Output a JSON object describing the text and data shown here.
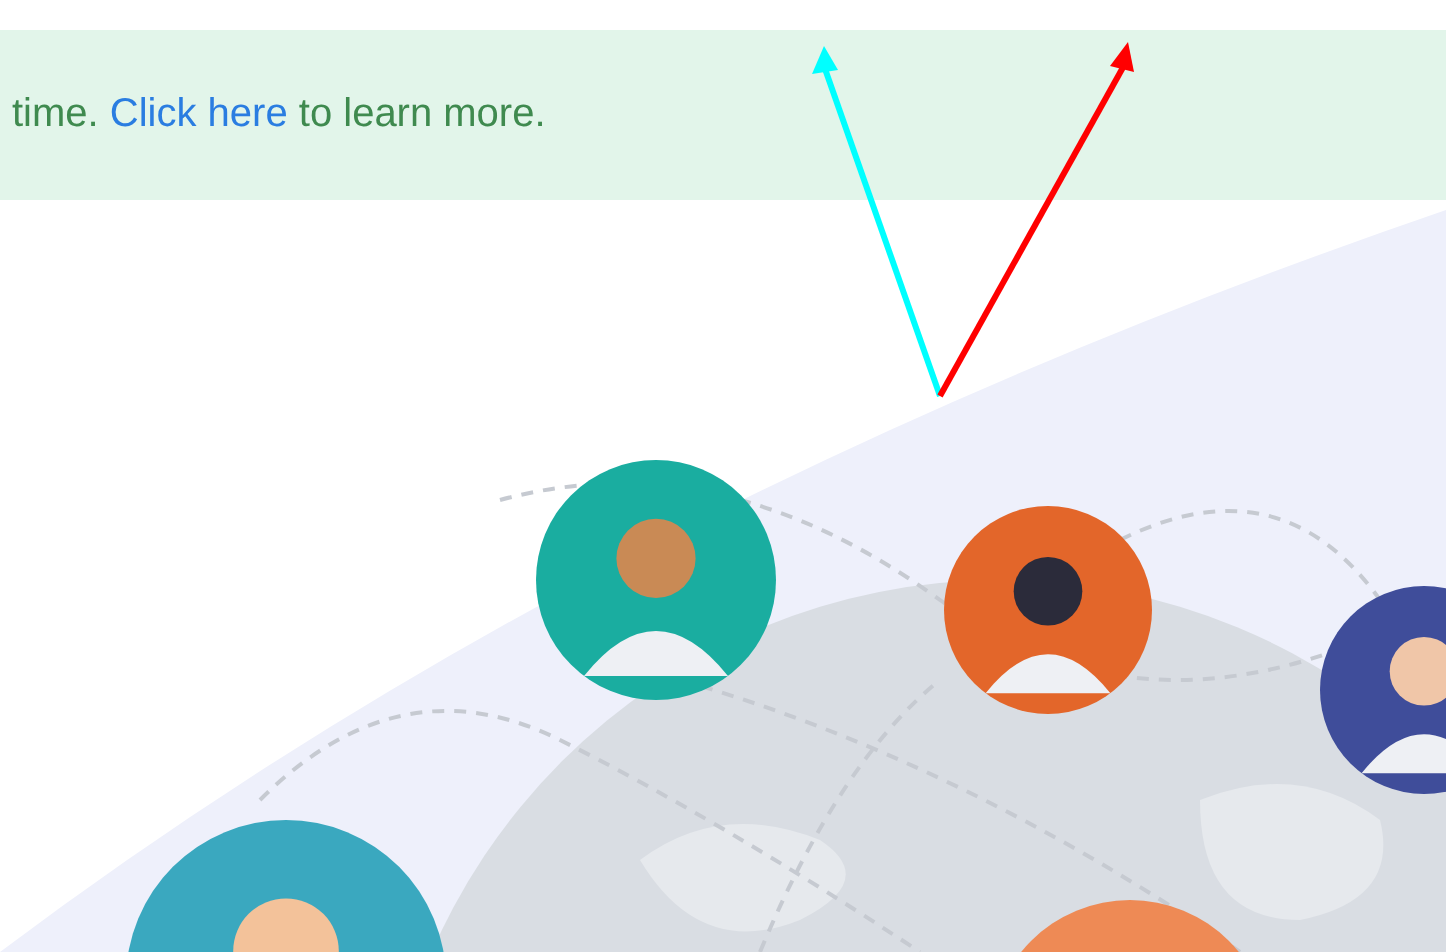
{
  "banner": {
    "text_before": "time.",
    "link": "Click here",
    "text_after": "to learn more."
  },
  "annotations": [
    {
      "kind": "arrow",
      "color": "#00ffff"
    },
    {
      "kind": "arrow",
      "color": "#ff0000"
    }
  ]
}
